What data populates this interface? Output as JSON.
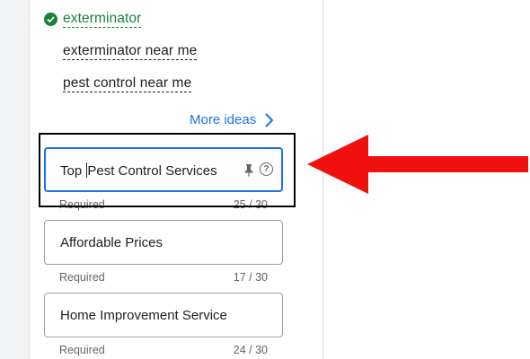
{
  "keywords": [
    {
      "text": "exterminator",
      "selected": true
    },
    {
      "text": "exterminator near me",
      "selected": false
    },
    {
      "text": "pest control near me",
      "selected": false
    }
  ],
  "more_ideas_label": "More ideas",
  "headlines": [
    {
      "value_before_caret": "Top ",
      "value_after_caret": "Pest Control Services",
      "helper": "Required",
      "count": "25 / 30"
    },
    {
      "value": "Affordable Prices",
      "helper": "Required",
      "count": "17 / 30"
    },
    {
      "value": "Home Improvement Service",
      "helper": "Required",
      "count": "24 / 30"
    }
  ],
  "colors": {
    "accent": "#1a73e8",
    "success": "#188038",
    "arrow": "#f0110f",
    "highlight_box": "#000000"
  },
  "icons": {
    "check": "check-circle-icon",
    "chevron": "chevron-right-icon",
    "pin": "pin-icon",
    "help": "help-circle-icon"
  }
}
